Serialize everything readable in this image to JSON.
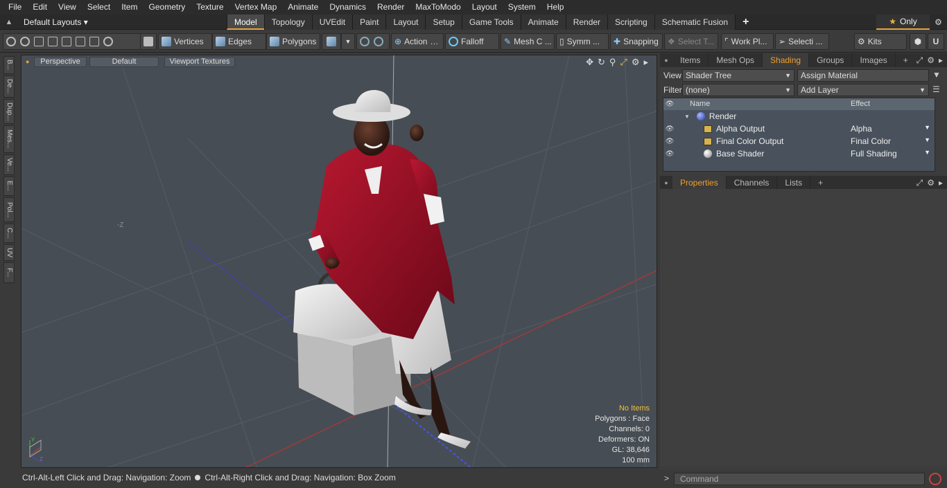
{
  "menu": [
    "File",
    "Edit",
    "View",
    "Select",
    "Item",
    "Geometry",
    "Texture",
    "Vertex Map",
    "Animate",
    "Dynamics",
    "Render",
    "MaxToModo",
    "Layout",
    "System",
    "Help"
  ],
  "layout": {
    "default_layouts": "Default Layouts ▾",
    "tabs": [
      "Model",
      "Topology",
      "UVEdit",
      "Paint",
      "Layout",
      "Setup",
      "Game Tools",
      "Animate",
      "Render",
      "Scripting",
      "Schematic Fusion"
    ],
    "active_tab": "Model",
    "only_label": "Only"
  },
  "toolbar": {
    "vertices": "Vertices",
    "edges": "Edges",
    "polygons": "Polygons",
    "action": "Action",
    "falloff": "Falloff",
    "mesh": "Mesh C ...",
    "symm": "Symm ...",
    "snapping": "Snapping",
    "select_t": "Select T...",
    "work_plane": "Work Pl...",
    "selection": "Selecti ...",
    "kits": "Kits"
  },
  "left_tabs": [
    "B...",
    "De...",
    "Dup...",
    "Mes...",
    "Ve...",
    "E...",
    "Pol...",
    "C...",
    "UV",
    "F..."
  ],
  "viewport": {
    "perspective": "Perspective",
    "default": "Default",
    "textures": "Viewport Textures",
    "axis_label": "-Z",
    "info": {
      "items": "No Items",
      "polygons": "Polygons : Face",
      "channels": "Channels: 0",
      "deformers": "Deformers: ON",
      "gl": "GL: 38,646",
      "scale": "100 mm"
    }
  },
  "status": {
    "left": "Ctrl-Alt-Left Click and Drag: Navigation: Zoom",
    "right": "Ctrl-Alt-Right Click and Drag: Navigation: Box Zoom"
  },
  "shading_panel": {
    "tabs": [
      "Items",
      "Mesh Ops",
      "Shading",
      "Groups",
      "Images"
    ],
    "active": "Shading",
    "view_label": "View",
    "view_value": "Shader Tree",
    "assign_material": "Assign Material",
    "filter_label": "Filter",
    "filter_value": "(none)",
    "add_layer": "Add Layer",
    "col_name": "Name",
    "col_effect": "Effect",
    "rows": [
      {
        "name": "Render",
        "effect": ""
      },
      {
        "name": "Alpha Output",
        "effect": "Alpha"
      },
      {
        "name": "Final Color Output",
        "effect": "Final Color"
      },
      {
        "name": "Base Shader",
        "effect": "Full Shading"
      }
    ]
  },
  "properties_panel": {
    "tabs": [
      "Properties",
      "Channels",
      "Lists"
    ],
    "active": "Properties"
  },
  "command": {
    "placeholder": "Command"
  }
}
